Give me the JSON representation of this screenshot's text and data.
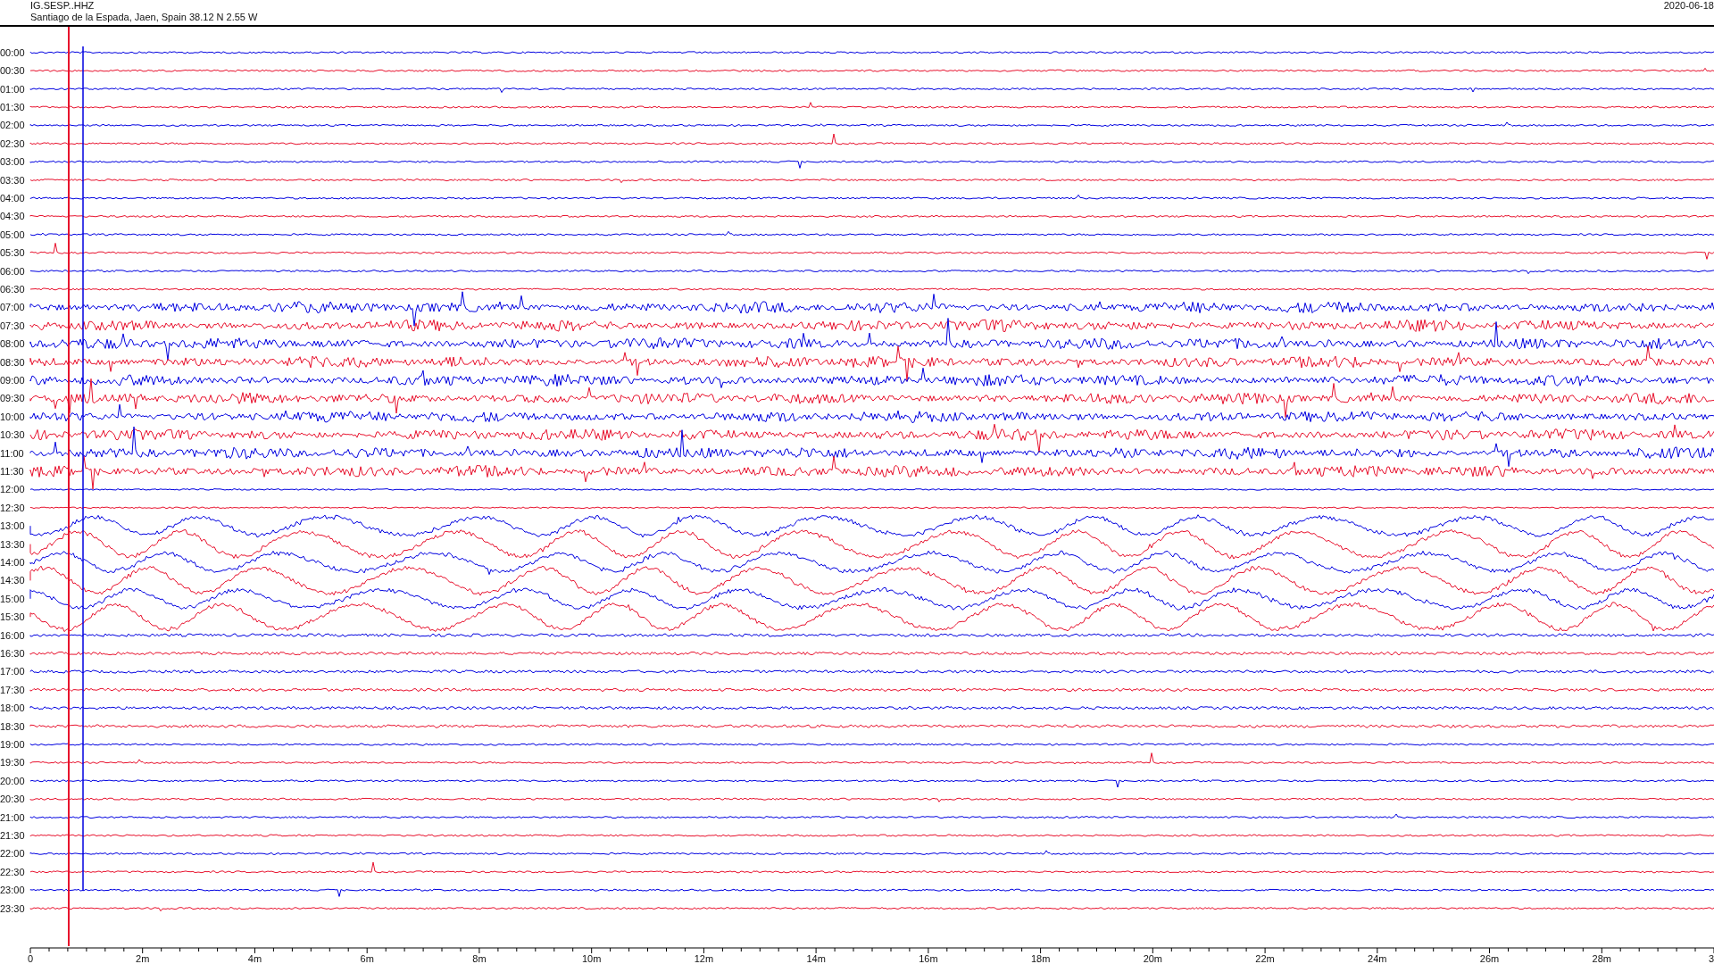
{
  "header": {
    "station": "IG.SESP..HHZ",
    "location": "Santiago de la Espada, Jaen, Spain  38.12 N 2.55 W",
    "date": "2020-06-18"
  },
  "rows": [
    "00:00",
    "00:30",
    "01:00",
    "01:30",
    "02:00",
    "02:30",
    "03:00",
    "03:30",
    "04:00",
    "04:30",
    "05:00",
    "05:30",
    "06:00",
    "06:30",
    "07:00",
    "07:30",
    "08:00",
    "08:30",
    "09:00",
    "09:30",
    "10:00",
    "10:30",
    "11:00",
    "11:30",
    "12:00",
    "12:30",
    "13:00",
    "13:30",
    "14:00",
    "14:30",
    "15:00",
    "15:30",
    "16:00",
    "16:30",
    "17:00",
    "17:30",
    "18:00",
    "18:30",
    "19:00",
    "19:30",
    "20:00",
    "20:30",
    "21:00",
    "21:30",
    "22:00",
    "22:30",
    "23:00",
    "23:30"
  ],
  "x_axis": [
    "0",
    "2m",
    "4m",
    "6m",
    "8m",
    "10m",
    "12m",
    "14m",
    "16m",
    "18m",
    "20m",
    "22m",
    "24m",
    "26m",
    "28m",
    "3"
  ]
}
